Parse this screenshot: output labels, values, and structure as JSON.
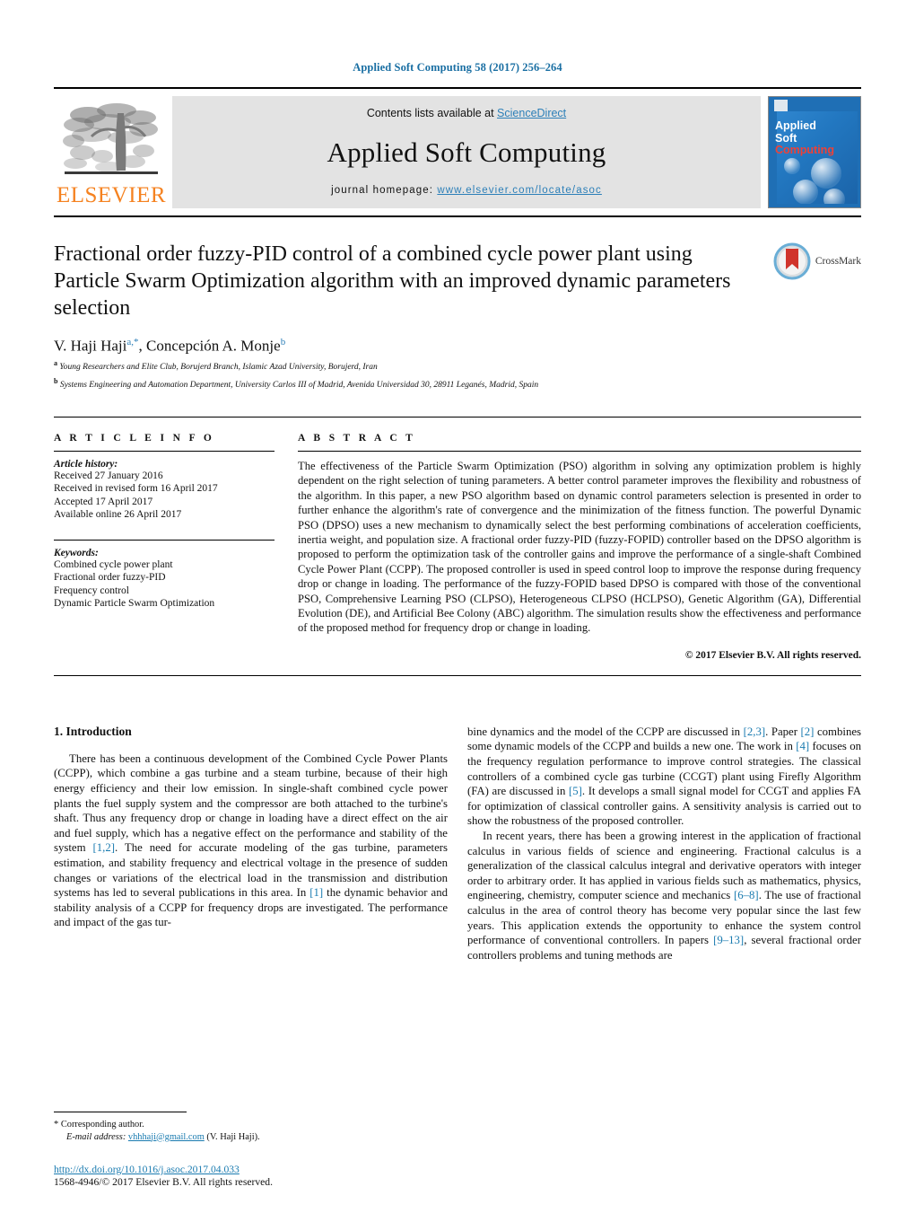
{
  "running_head": "Applied Soft Computing 58 (2017) 256–264",
  "masthead": {
    "contents_prefix": "Contents lists available at ",
    "sciencedirect": "ScienceDirect",
    "journal_title": "Applied Soft Computing",
    "homepage_prefix": "journal homepage: ",
    "homepage_url": "www.elsevier.com/locate/asoc",
    "publisher_wordmark": "ELSEVIER",
    "cover": {
      "line1": "Applied",
      "line2": "Soft",
      "line3": "Computing"
    },
    "colors": {
      "link": "#2c7fb8",
      "elsevier_orange": "#F58220",
      "cover_blue": "#1f6fb5",
      "cover_red": "#ef4136"
    }
  },
  "article": {
    "title": "Fractional order fuzzy-PID control of a combined cycle power plant using Particle Swarm Optimization algorithm with an improved dynamic parameters selection",
    "authors_html": "V. Haji Haji<sup>a,*</sup>, Concepción A. Monje<sup>b</sup>",
    "affiliations": [
      {
        "marker": "a",
        "text": "Young Researchers and Elite Club, Borujerd Branch, Islamic Azad University, Borujerd, Iran"
      },
      {
        "marker": "b",
        "text": "Systems Engineering and Automation Department, University Carlos III of Madrid, Avenida Universidad 30, 28911 Leganés, Madrid, Spain"
      }
    ],
    "crossmark_label": "CrossMark"
  },
  "article_info": {
    "heading": "A R T I C L E   I N F O",
    "history_label": "Article history:",
    "history": [
      "Received 27 January 2016",
      "Received in revised form 16 April 2017",
      "Accepted 17 April 2017",
      "Available online 26 April 2017"
    ],
    "keywords_label": "Keywords:",
    "keywords": [
      "Combined cycle power plant",
      "Fractional order fuzzy-PID",
      "Frequency control",
      "Dynamic Particle Swarm Optimization"
    ]
  },
  "abstract": {
    "heading": "A B S T R A C T",
    "text": "The effectiveness of the Particle Swarm Optimization (PSO) algorithm in solving any optimization problem is highly dependent on the right selection of tuning parameters. A better control parameter improves the flexibility and robustness of the algorithm. In this paper, a new PSO algorithm based on dynamic control parameters selection is presented in order to further enhance the algorithm's rate of convergence and the minimization of the fitness function. The powerful Dynamic PSO (DPSO) uses a new mechanism to dynamically select the best performing combinations of acceleration coefficients, inertia weight, and population size. A fractional order fuzzy-PID (fuzzy-FOPID) controller based on the DPSO algorithm is proposed to perform the optimization task of the controller gains and improve the performance of a single-shaft Combined Cycle Power Plant (CCPP). The proposed controller is used in speed control loop to improve the response during frequency drop or change in loading. The performance of the fuzzy-FOPID based DPSO is compared with those of the conventional PSO, Comprehensive Learning PSO (CLPSO), Heterogeneous CLPSO (HCLPSO), Genetic Algorithm (GA), Differential Evolution (DE), and Artificial Bee Colony (ABC) algorithm. The simulation results show the effectiveness and performance of the proposed method for frequency drop or change in loading.",
    "copyright": "© 2017 Elsevier B.V. All rights reserved."
  },
  "introduction": {
    "section_number_title": "1.  Introduction",
    "left_paragraph_parts": [
      "There has been a continuous development of the Combined Cycle Power Plants (CCPP), which combine a gas turbine and a steam turbine, because of their high energy efficiency and their low emission. In single-shaft combined cycle power plants the fuel supply system and the compressor are both attached to the turbine's shaft. Thus any frequency drop or change in loading have a direct effect on the air and fuel supply, which has a negative effect on the performance and stability of the system ",
      "[1,2]",
      ". The need for accurate modeling of the gas turbine, parameters estimation, and stability frequency and electrical voltage in the presence of sudden changes or variations of the electrical load in the transmission and distribution systems has led to several publications in this area. In ",
      "[1]",
      " the dynamic behavior and stability analysis of a CCPP for frequency drops are investigated. The performance and impact of the gas tur-"
    ],
    "right_paragraph1_parts": [
      "bine dynamics and the model of the CCPP are discussed in ",
      "[2,3]",
      ". Paper ",
      "[2]",
      " combines some dynamic models of the CCPP and builds a new one. The work in ",
      "[4]",
      " focuses on the frequency regulation performance to improve control strategies. The classical controllers of a combined cycle gas turbine (CCGT) plant using Firefly Algorithm (FA) are discussed in ",
      "[5]",
      ". It develops a small signal model for CCGT and applies FA for optimization of classical controller gains. A sensitivity analysis is carried out to show the robustness of the proposed controller."
    ],
    "right_paragraph2_parts": [
      "In recent years, there has been a growing interest in the application of fractional calculus in various fields of science and engineering. Fractional calculus is a generalization of the classical calculus integral and derivative operators with integer order to arbitrary order. It has applied in various fields such as mathematics, physics, engineering, chemistry, computer science and mechanics ",
      "[6–8]",
      ". The use of fractional calculus in the area of control theory has become very popular since the last few years. This application extends the opportunity to enhance the system control performance of conventional controllers. In papers ",
      "[9–13]",
      ", several fractional order controllers problems and tuning methods are"
    ]
  },
  "footnote": {
    "corresponding_marker": "*",
    "corresponding_text": "Corresponding author.",
    "email_label": "E-mail address:",
    "email": "vhhhaji@gmail.com",
    "email_owner": "(V. Haji Haji)."
  },
  "doi": {
    "url": "http://dx.doi.org/10.1016/j.asoc.2017.04.033",
    "issn_line": "1568-4946/© 2017 Elsevier B.V. All rights reserved."
  }
}
